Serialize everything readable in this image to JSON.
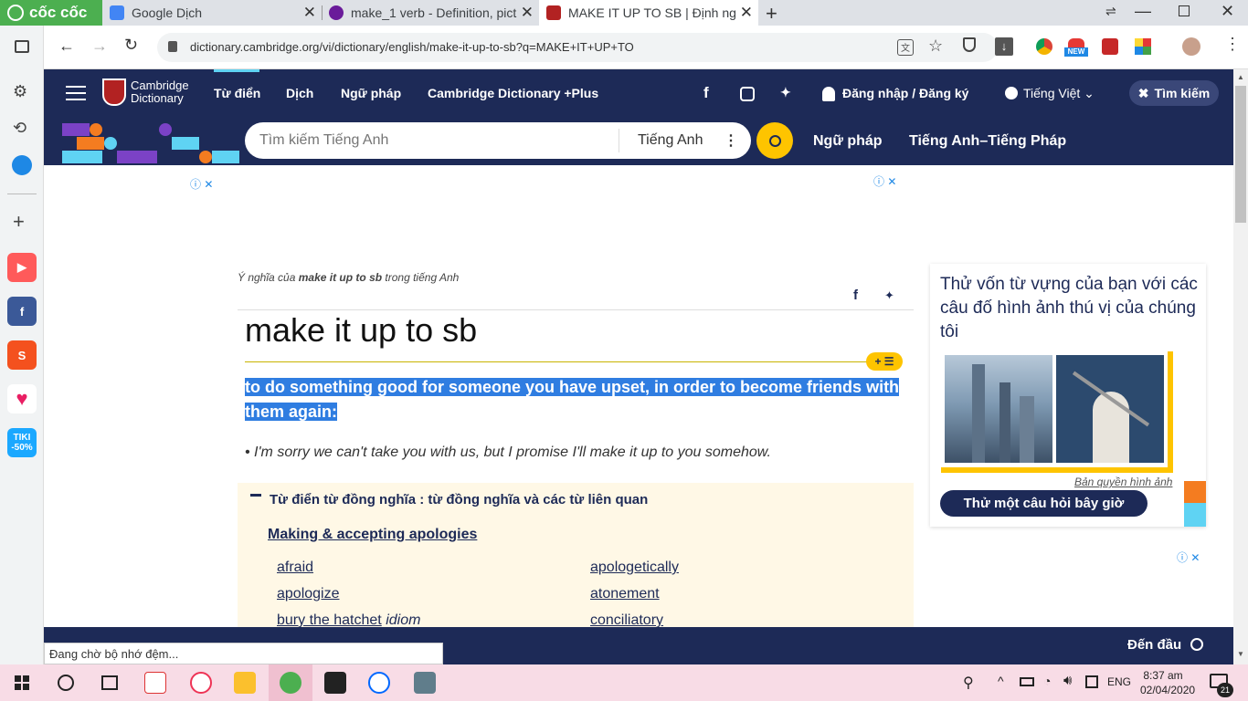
{
  "browser": {
    "brand": "cốc cốc",
    "tabs": [
      {
        "title": "Google Dịch"
      },
      {
        "title": "make_1 verb - Definition, pict"
      },
      {
        "title": "MAKE IT UP TO SB | Định ngh"
      }
    ],
    "url": "dictionary.cambridge.org/vi/dictionary/english/make-it-up-to-sb?q=MAKE+IT+UP+TO",
    "new_badge": "NEW",
    "status_text": "Đang chờ bộ nhớ đệm...",
    "colors": {
      "accent": "#4caf50",
      "tabbar": "#dee1e6"
    }
  },
  "sidebar": {
    "tiki_label": "TIKI",
    "tiki_discount": "-50%"
  },
  "site": {
    "logo_line1": "Cambridge",
    "logo_line2": "Dictionary",
    "nav": [
      "Từ điển",
      "Dịch",
      "Ngữ pháp",
      "Cambridge Dictionary +Plus"
    ],
    "login": "Đăng nhập / Đăng ký",
    "language": "Tiếng Việt",
    "search_button": "Tìm kiếm",
    "search_placeholder": "Tìm kiếm Tiếng Anh",
    "search_lang": "Tiếng Anh",
    "sub_links": [
      "Ngữ pháp",
      "Tiếng Anh–Tiếng Pháp"
    ],
    "colors": {
      "navy": "#1d2a57",
      "yellow": "#fec400",
      "highlight": "#2f7de1",
      "synonym_bg": "#fff8e6"
    }
  },
  "entry": {
    "breadcrumb_pre": "Ý nghĩa của ",
    "breadcrumb_term": "make it up to sb",
    "breadcrumb_post": " trong tiếng Anh",
    "headword": "make it up to sb",
    "definition": "to do something good for someone you have upset, in order to become friends with them again:",
    "example": "I'm sorry we can't take you with us, but I promise I'll make it up to you somehow.",
    "synonym_header": "Từ điển từ đồng nghĩa : từ đồng nghĩa và các từ liên quan",
    "synonym_category": "Making & accepting apologies",
    "synonyms_left": [
      {
        "word": "afraid",
        "note": ""
      },
      {
        "word": "apologize",
        "note": ""
      },
      {
        "word": "bury the hatchet",
        "note": "idiom"
      }
    ],
    "synonyms_right": [
      {
        "word": "apologetically",
        "note": ""
      },
      {
        "word": "atonement",
        "note": ""
      },
      {
        "word": "conciliatory",
        "note": ""
      }
    ]
  },
  "quiz": {
    "text": "Thử vốn từ vựng của bạn với các câu đố hình ảnh thú vị của chúng tôi",
    "credit": "Bản quyền hình ảnh",
    "button": "Thử một câu hỏi bây giờ"
  },
  "bottom": {
    "back_to_top": "Đến đầu"
  },
  "taskbar": {
    "lang": "ENG",
    "time": "8:37 am",
    "date": "02/04/2020",
    "notifications": "21"
  }
}
